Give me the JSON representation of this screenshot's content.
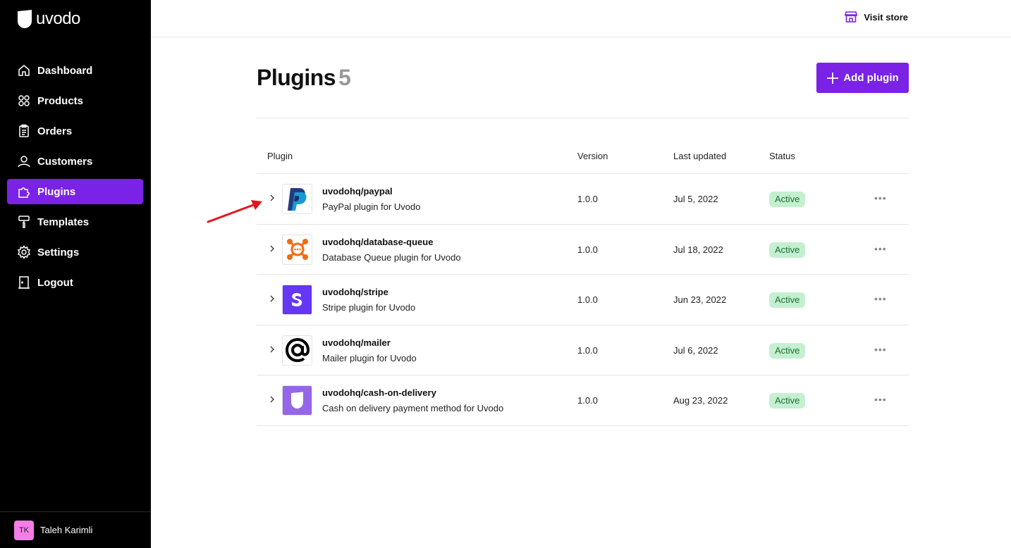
{
  "brand": {
    "name": "uvodo"
  },
  "nav": {
    "items": [
      {
        "label": "Dashboard",
        "icon": "home-icon",
        "active": false
      },
      {
        "label": "Products",
        "icon": "grid-icon",
        "active": false
      },
      {
        "label": "Orders",
        "icon": "clipboard-icon",
        "active": false
      },
      {
        "label": "Customers",
        "icon": "user-icon",
        "active": false
      },
      {
        "label": "Plugins",
        "icon": "puzzle-icon",
        "active": true
      },
      {
        "label": "Templates",
        "icon": "paint-roller-icon",
        "active": false
      },
      {
        "label": "Settings",
        "icon": "gear-icon",
        "active": false
      },
      {
        "label": "Logout",
        "icon": "door-icon",
        "active": false
      }
    ]
  },
  "user": {
    "initials": "TK",
    "name": "Taleh Karimli"
  },
  "topbar": {
    "visit_label": "Visit store",
    "visit_icon": "store-icon"
  },
  "page": {
    "title": "Plugins",
    "count": "5",
    "add_label": "Add plugin"
  },
  "table": {
    "headers": {
      "plugin": "Plugin",
      "version": "Version",
      "updated": "Last updated",
      "status": "Status"
    },
    "rows": [
      {
        "name": "uvodohq/paypal",
        "desc": "PayPal plugin for Uvodo",
        "version": "1.0.0",
        "updated": "Jul 5, 2022",
        "status": "Active",
        "logo": "paypal-logo"
      },
      {
        "name": "uvodohq/database-queue",
        "desc": "Database Queue plugin for Uvodo",
        "version": "1.0.0",
        "updated": "Jul 18, 2022",
        "status": "Active",
        "logo": "database-queue-logo"
      },
      {
        "name": "uvodohq/stripe",
        "desc": "Stripe plugin for Uvodo",
        "version": "1.0.0",
        "updated": "Jun 23, 2022",
        "status": "Active",
        "logo": "stripe-logo"
      },
      {
        "name": "uvodohq/mailer",
        "desc": "Mailer plugin for Uvodo",
        "version": "1.0.0",
        "updated": "Jul 6, 2022",
        "status": "Active",
        "logo": "mailer-logo"
      },
      {
        "name": "uvodohq/cash-on-delivery",
        "desc": "Cash on delivery payment method for Uvodo",
        "version": "1.0.0",
        "updated": "Aug 23, 2022",
        "status": "Active",
        "logo": "cash-on-delivery-logo"
      }
    ]
  },
  "colors": {
    "accent": "#7a22e6",
    "sidebar": "#000000",
    "active_badge": "#c4f0cf",
    "annotation_arrow": "#e8141b"
  }
}
